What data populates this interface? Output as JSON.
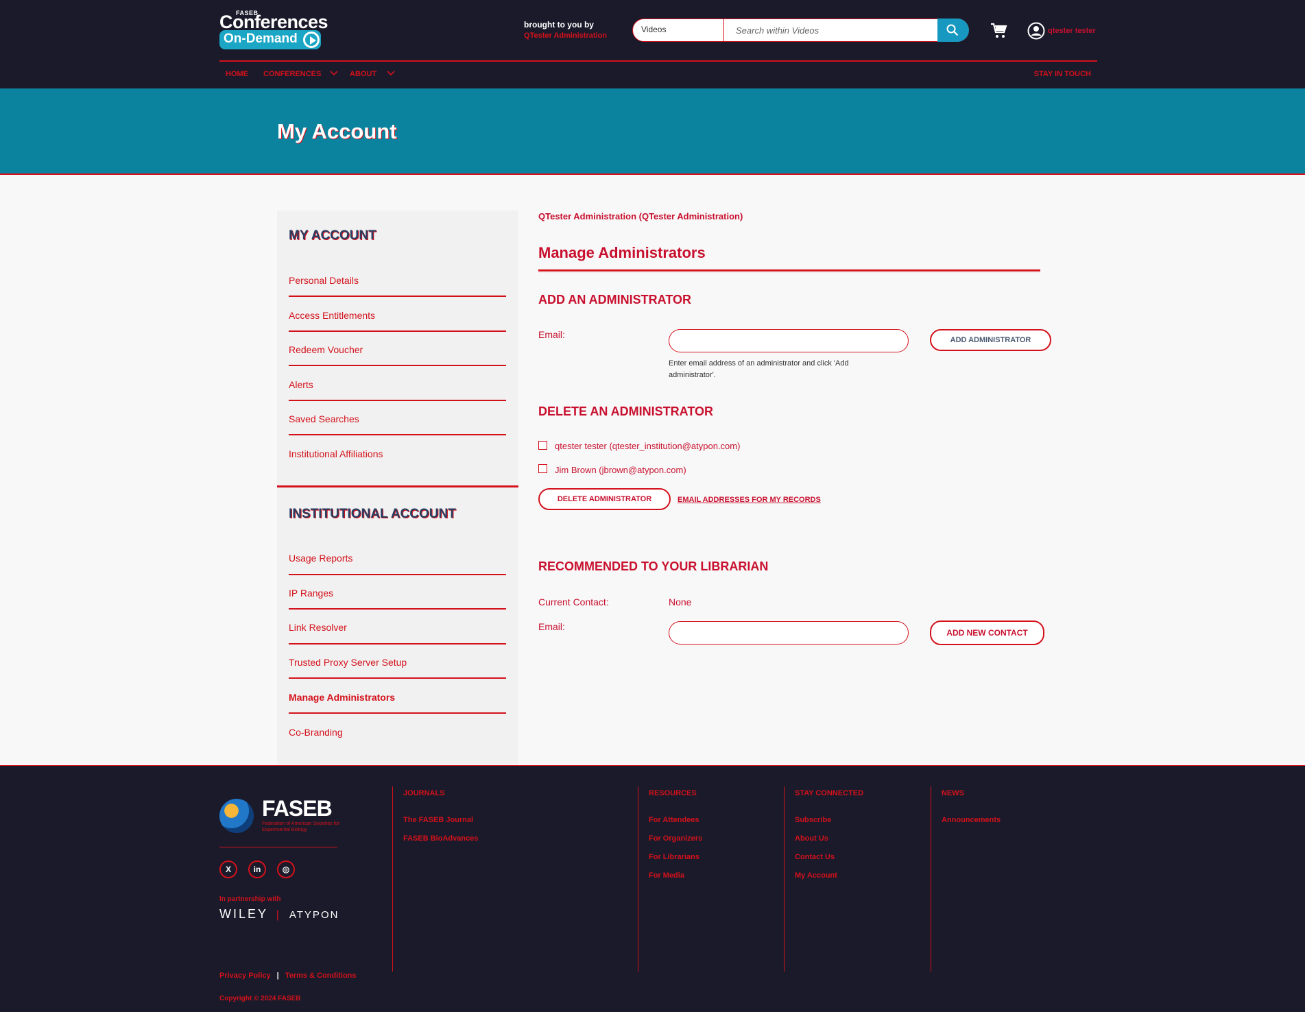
{
  "header": {
    "logo": {
      "faseb_small": "FASEB",
      "line1": "Conferences",
      "line2": "On-Demand"
    },
    "brought_by": {
      "label": "brought to you by",
      "institution": "QTester Administration"
    },
    "search": {
      "scope": "Videos",
      "placeholder": "Search within Videos"
    },
    "user_name": "qtester tester",
    "nav": [
      {
        "label": "HOME"
      },
      {
        "label": "CONFERENCES"
      },
      {
        "label": "ABOUT"
      }
    ],
    "stay_in_touch": "STAY IN TOUCH"
  },
  "banner": {
    "title": "My Account"
  },
  "sidebar": {
    "my_account_heading": "MY ACCOUNT",
    "my_account_links": [
      {
        "label": "Personal Details"
      },
      {
        "label": "Access Entitlements"
      },
      {
        "label": "Redeem Voucher"
      },
      {
        "label": "Alerts"
      },
      {
        "label": "Saved Searches"
      },
      {
        "label": "Institutional Affiliations"
      }
    ],
    "institutional_heading": "INSTITUTIONAL ACCOUNT",
    "institutional_links": [
      {
        "label": "Usage Reports"
      },
      {
        "label": "IP Ranges"
      },
      {
        "label": "Link Resolver"
      },
      {
        "label": "Trusted Proxy Server Setup"
      },
      {
        "label": "Manage Administrators",
        "active": true
      },
      {
        "label": "Co-Branding"
      }
    ]
  },
  "main": {
    "institution": "QTester Administration (QTester Administration)",
    "title": "Manage Administrators",
    "add_section": {
      "heading": "ADD AN ADMINISTRATOR",
      "email_label": "Email:",
      "email_value": "",
      "help": "Enter email address of an administrator and click 'Add administrator'.",
      "button": "ADD ADMINISTRATOR"
    },
    "delete_section": {
      "heading": "DELETE AN ADMINISTRATOR",
      "admins": [
        {
          "label": "qtester tester (qtester_institution@atypon.com)"
        },
        {
          "label": "Jim Brown (jbrown@atypon.com)"
        }
      ],
      "button": "DELETE ADMINISTRATOR",
      "link": "EMAIL ADDRESSES FOR MY RECORDS"
    },
    "recommend_section": {
      "heading": "RECOMMENDED TO YOUR LIBRARIAN",
      "contact_label": "Current Contact:",
      "contact_value": "None",
      "email_label": "Email:",
      "email_value": "",
      "button": "ADD NEW CONTACT"
    }
  },
  "footer": {
    "logo": {
      "word": "FASEB",
      "sub": "Federation of American Societies for Experimental Biology"
    },
    "social": [
      {
        "icon": "x-icon",
        "glyph": "X"
      },
      {
        "icon": "linkedin-icon",
        "glyph": "in"
      },
      {
        "icon": "instagram-icon",
        "glyph": "◎"
      }
    ],
    "partner_label": "In partnership with",
    "partner_wiley": "WILEY",
    "partner_atypon": "ATYPON",
    "columns": [
      {
        "heading": "JOURNALS",
        "links": [
          "The FASEB Journal",
          "FASEB BioAdvances"
        ]
      },
      {
        "heading": "RESOURCES",
        "links": [
          "For Attendees",
          "For Organizers",
          "For Librarians",
          "For Media"
        ]
      },
      {
        "heading": "STAY CONNECTED",
        "links": [
          "Subscribe",
          "About Us",
          "Contact Us",
          "My Account"
        ]
      },
      {
        "heading": "NEWS",
        "links": [
          "Announcements"
        ]
      }
    ],
    "privacy": "Privacy Policy",
    "terms": "Terms & Conditions",
    "copyright": "Copyright © 2024 FASEB"
  }
}
